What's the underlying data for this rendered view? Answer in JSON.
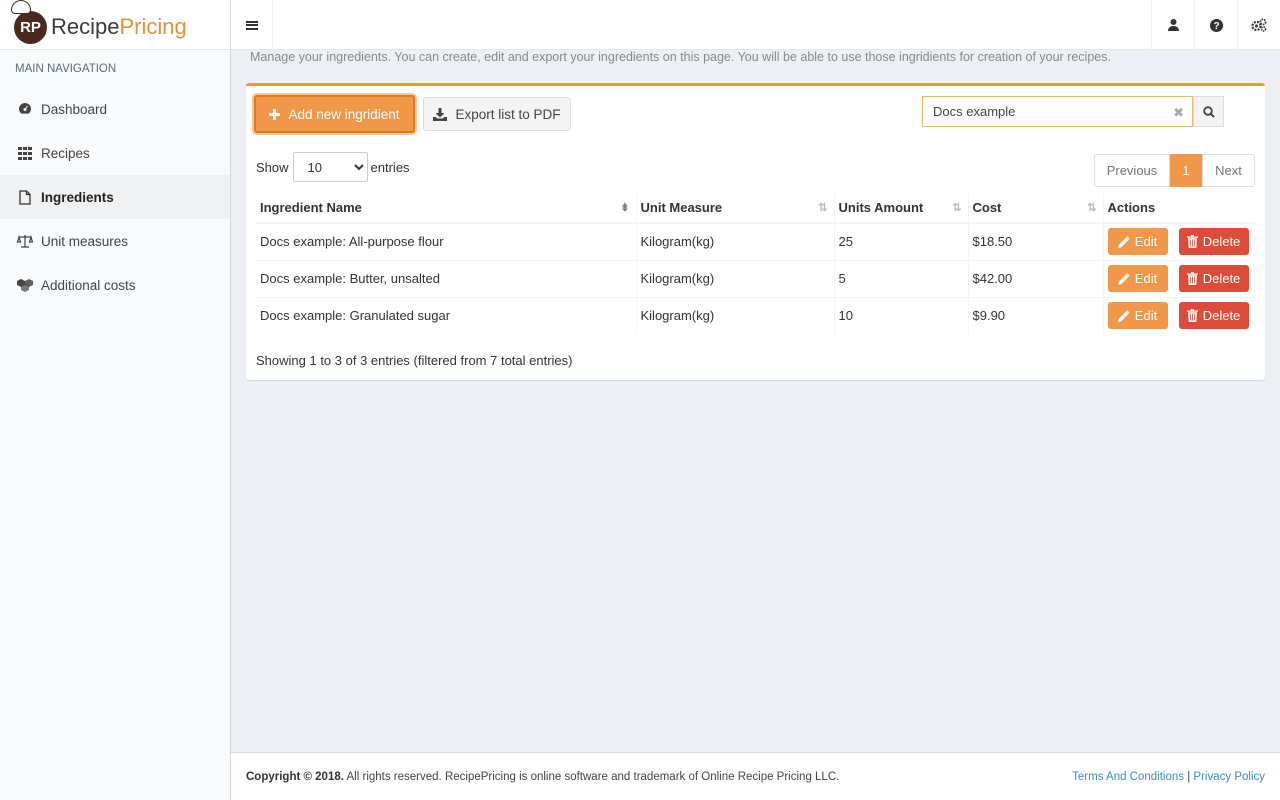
{
  "brand": {
    "badge": "RP",
    "name_part1": "Recipe",
    "name_part2": "Pricing"
  },
  "sidebar": {
    "header": "MAIN NAVIGATION",
    "items": [
      {
        "label": "Dashboard",
        "icon": "dashboard-icon"
      },
      {
        "label": "Recipes",
        "icon": "grid-icon"
      },
      {
        "label": "Ingredients",
        "icon": "file-icon",
        "active": true
      },
      {
        "label": "Unit measures",
        "icon": "balance-scale-icon"
      },
      {
        "label": "Additional costs",
        "icon": "cubes-icon"
      }
    ]
  },
  "topbar": {
    "icons": [
      "user-icon",
      "help-icon",
      "settings-icon"
    ]
  },
  "page": {
    "description": "Manage your ingredients. You can create, edit and export your ingredients on this page. You will be able to use those ingridients for creation of your recipes."
  },
  "toolbar": {
    "add_label": "Add new ingridient",
    "export_label": "Export list to PDF"
  },
  "search": {
    "value": "Docs example",
    "clear_glyph": "✖"
  },
  "entries": {
    "show_label": "Show",
    "value": "10",
    "options": [
      "10"
    ],
    "suffix": "entries"
  },
  "pagination": {
    "previous": "Previous",
    "current": "1",
    "next": "Next"
  },
  "table": {
    "columns": [
      "Ingredient Name",
      "Unit Measure",
      "Units Amount",
      "Cost",
      "Actions"
    ],
    "rows": [
      {
        "name": "Docs example: All-purpose flour",
        "unit": "Kilogram(kg)",
        "amount": "25",
        "cost": "$18.50"
      },
      {
        "name": "Docs example: Butter, unsalted",
        "unit": "Kilogram(kg)",
        "amount": "5",
        "cost": "$42.00"
      },
      {
        "name": "Docs example: Granulated sugar",
        "unit": "Kilogram(kg)",
        "amount": "10",
        "cost": "$9.90"
      }
    ],
    "edit_label": "Edit",
    "delete_label": "Delete"
  },
  "info": "Showing 1 to 3 of 3 entries (filtered from 7 total entries)",
  "footer": {
    "copyright_bold": "Copyright © 2018.",
    "copyright_rest": " All rights reserved. RecipePricing is online software and trademark of Online Recipe Pricing LLC.",
    "terms": "Terms And Conditions",
    "separator": " | ",
    "privacy": "Privacy Policy"
  },
  "colors": {
    "accent": "#f0974a",
    "danger": "#dd4b39",
    "link": "#3c8dbc",
    "brand_dark": "#4a2a1d"
  }
}
